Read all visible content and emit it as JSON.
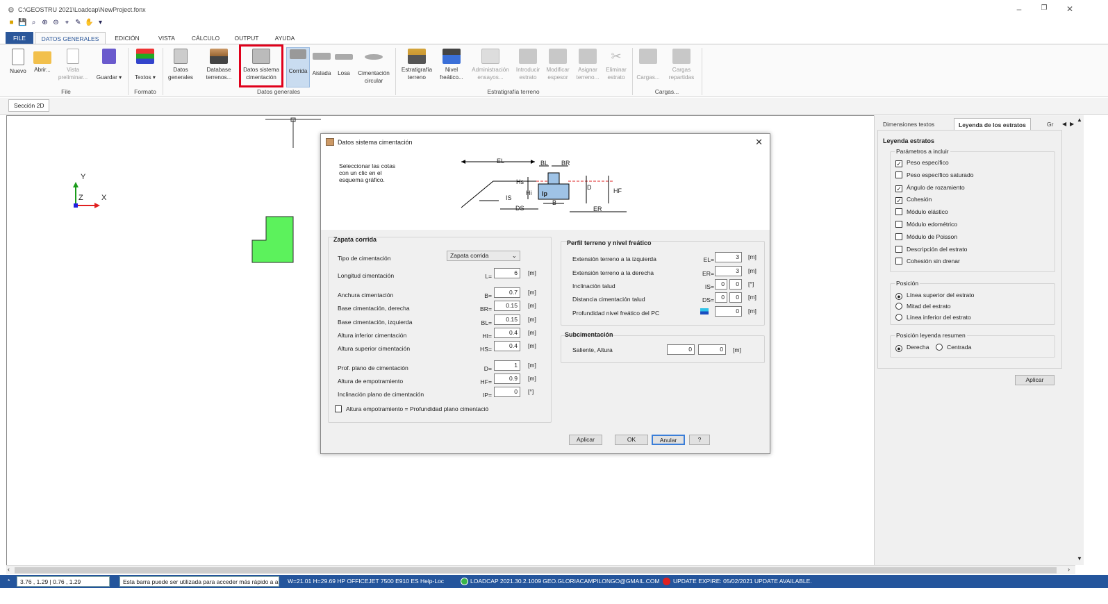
{
  "window": {
    "title": "C:\\GEOSTRU 2021\\Loadcap\\NewProject.fonx"
  },
  "menu_tabs": [
    "FILE",
    "DATOS GENERALES",
    "EDICIÓN",
    "VISTA",
    "CÁLCULO",
    "OUTPUT",
    "AYUDA"
  ],
  "ribbon": {
    "file": {
      "group": "File",
      "nuevo": "Nuevo",
      "abrir": "Abrir...",
      "vista1": "Vista",
      "vista2": "preliminar...",
      "guardar": "Guardar"
    },
    "formato": {
      "group": "Formato",
      "textos": "Textos"
    },
    "datos": {
      "group": "Datos generales",
      "dg1": "Datos",
      "dg2": "generales",
      "db1": "Database",
      "db2": "terrenos...",
      "ds1": "Datos sistema",
      "ds2": "cimentación",
      "corrida": "Corrida",
      "aislada": "Aislada",
      "losa": "Losa",
      "cc1": "Cimentación",
      "cc2": "circular"
    },
    "estrat": {
      "group": "Estratigrafía terreno",
      "e1": "Estratigrafía",
      "e2": "terreno",
      "nf1": "Nivel",
      "nf2": "freático...",
      "ad1": "Administración",
      "ad2": "ensayos...",
      "in1": "Introducir",
      "in2": "estrato",
      "mo1": "Modificar",
      "mo2": "espesor",
      "as1": "Asignar",
      "as2": "terreno...",
      "el1": "Eliminar",
      "el2": "estrato"
    },
    "cargas": {
      "group": "Cargas...",
      "c1": "Cargas...",
      "cr1": "Cargas",
      "cr2": "repartidas"
    }
  },
  "sheet_tab": "Sección 2D",
  "axes": {
    "y": "Y",
    "x": "X",
    "z": "Z"
  },
  "right_panel": {
    "tabs": [
      "Dimensiones textos",
      "Leyenda de los estratos",
      "Gr"
    ],
    "legend_title": "Leyenda estratos",
    "params_title": "Parámetros a incluir",
    "params": [
      {
        "label": "Peso específico",
        "checked": "✓"
      },
      {
        "label": "Peso específico saturado",
        "checked": ""
      },
      {
        "label": "Ángulo de rozamiento",
        "checked": "✓"
      },
      {
        "label": "Cohesión",
        "checked": "✓"
      },
      {
        "label": "Módulo elástico",
        "checked": ""
      },
      {
        "label": "Módulo edométrico",
        "checked": ""
      },
      {
        "label": "Módulo de Poisson",
        "checked": ""
      },
      {
        "label": "Descripción del estrato",
        "checked": ""
      },
      {
        "label": "Cohesión sin drenar",
        "checked": ""
      }
    ],
    "posicion_title": "Posición",
    "posicion": [
      "Línea superior del estrato",
      "Mitad del estrato",
      "Línea inferior del estrato"
    ],
    "resumen_title": "Posición leyenda resumen",
    "resumen": [
      "Derecha",
      "Centrada"
    ],
    "apply": "Aplicar"
  },
  "dialog": {
    "title": "Datos sistema cimentación",
    "hint": [
      "Seleccionar las cotas",
      "con un clic en el",
      "esquema gráfico."
    ],
    "diagram_labels": {
      "EL": "EL",
      "BL": "BL",
      "BR": "BR",
      "Hs": "Hs",
      "Hi": "Hi",
      "IS": "IS",
      "Ip": "Ip",
      "B": "B",
      "D": "D",
      "HF": "HF",
      "DS": "DS",
      "ER": "ER"
    },
    "left_group": "Zapata corrida",
    "tipo_label": "Tipo de cimentación",
    "tipo_value": "Zapata corrida",
    "rows": [
      {
        "label": "Longitud cimentación",
        "sym": "L=",
        "val": "6",
        "unit": "[m]"
      },
      {
        "label": "Anchura cimentación",
        "sym": "B=",
        "val": "0.7",
        "unit": "[m]"
      },
      {
        "label": "Base cimentación, derecha",
        "sym": "BR=",
        "val": "0.15",
        "unit": "[m]"
      },
      {
        "label": "Base cimentación, izquierda",
        "sym": "BL=",
        "val": "0.15",
        "unit": "[m]"
      },
      {
        "label": "Altura inferior cimentación",
        "sym": "HI=",
        "val": "0.4",
        "unit": "[m]"
      },
      {
        "label": "Altura superior cimentación",
        "sym": "HS=",
        "val": "0.4",
        "unit": "[m]"
      },
      {
        "label": "Prof. plano de cimentación",
        "sym": "D=",
        "val": "1",
        "unit": "[m]"
      },
      {
        "label": "Altura de empotramiento",
        "sym": "HF=",
        "val": "0.9",
        "unit": "[m]"
      },
      {
        "label": "Inclinación plano de cimentación",
        "sym": "IP=",
        "val": "0",
        "unit": "[°]"
      }
    ],
    "checkbox_label": "Altura empotramiento = Profundidad plano cimentació",
    "right_group": "Perfil terreno y nivel freático",
    "rrows": [
      {
        "label": "Extensión terreno a la izquierda",
        "sym": "EL=",
        "val": "3",
        "unit": "[m]"
      },
      {
        "label": "Extensión terreno a la derecha",
        "sym": "ER=",
        "val": "3",
        "unit": "[m]"
      },
      {
        "label": "Inclinación talud",
        "sym": "IS=",
        "v1": "0",
        "v2": "0",
        "unit": "[°]"
      },
      {
        "label": "Distancia cimentación talud",
        "sym": "DS=",
        "v1": "0",
        "v2": "0",
        "unit": "[m]"
      },
      {
        "label": "Profundidad nivel freático del PC",
        "sym": "",
        "val": "0",
        "unit": "[m]"
      }
    ],
    "sub_group": "Subcimentación",
    "sub_label": "Saliente, Altura",
    "sub_v1": "0",
    "sub_v2": "0",
    "sub_unit": "[m]",
    "buttons": {
      "apply": "Aplicar",
      "ok": "OK",
      "cancel": "Anular",
      "help": "?"
    }
  },
  "status": {
    "star": "*",
    "coords": "3.76 , 1.29 | 0.76 , 1.29",
    "hint": "Esta barra puede ser utilizada para acceder más rápido a a",
    "printer": "W=21.01 H=29.69 HP OFFICEJET 7500 E910  ES  Help-Loc",
    "version": "LOADCAP 2021.30.2.1009 GEO.GLORIACAMPILONGO@GMAIL.COM",
    "update": "UPDATE EXPIRE: 05/02/2021 UPDATE AVAILABLE."
  },
  "colors": {
    "accent": "#2b579a",
    "status_bg": "#24559c",
    "highlight": "#e0001b",
    "footing": "#5cf25c"
  }
}
